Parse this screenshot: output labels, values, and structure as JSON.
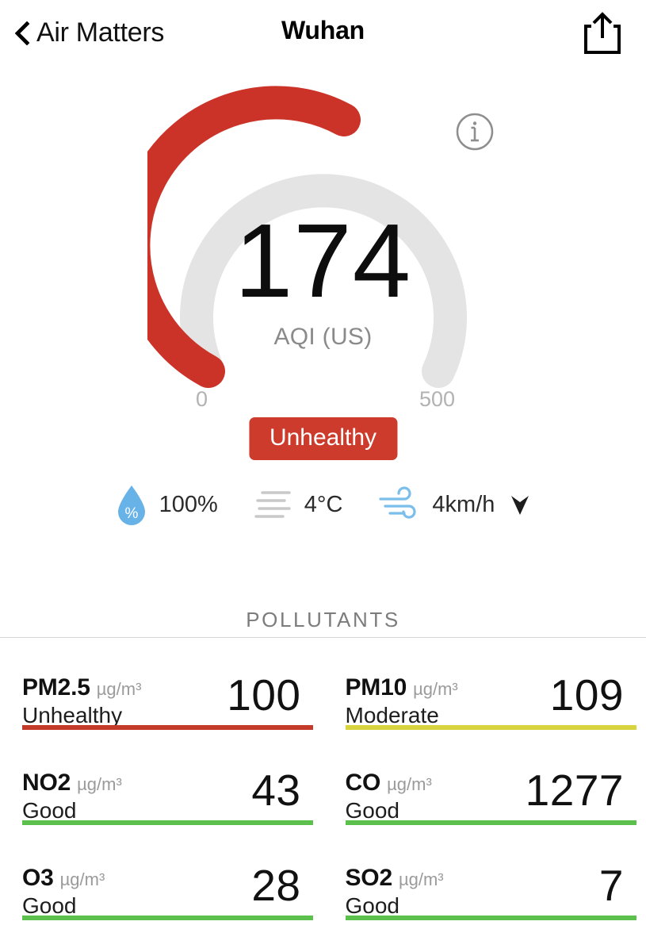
{
  "header": {
    "back_label": "Air Matters",
    "title": "Wuhan",
    "back_icon": "chevron-left-icon",
    "share_icon": "share-icon"
  },
  "gauge": {
    "value": "174",
    "unit_label": "AQI (US)",
    "scale_min": "0",
    "scale_max": "500",
    "info_icon": "info-circle-icon",
    "status_label": "Unhealthy"
  },
  "weather": {
    "humidity": {
      "icon": "humidity-droplet-icon",
      "value": "100%"
    },
    "temperature": {
      "icon": "temperature-lines-icon",
      "value": "4°C"
    },
    "wind": {
      "icon": "wind-icon",
      "value": "4km/h",
      "direction_icon": "wind-direction-arrow-icon"
    }
  },
  "pollutants": {
    "section_title": "POLLUTANTS",
    "items": [
      {
        "name": "PM2.5",
        "unit": "µg/m³",
        "status": "Unhealthy",
        "value": "100",
        "color": "#C33A28"
      },
      {
        "name": "PM10",
        "unit": "µg/m³",
        "status": "Moderate",
        "value": "109",
        "color": "#D8D43F"
      },
      {
        "name": "NO2",
        "unit": "µg/m³",
        "status": "Good",
        "value": "43",
        "color": "#5CC14C"
      },
      {
        "name": "CO",
        "unit": "µg/m³",
        "status": "Good",
        "value": "1277",
        "color": "#5CC14C"
      },
      {
        "name": "O3",
        "unit": "µg/m³",
        "status": "Good",
        "value": "28",
        "color": "#5CC14C"
      },
      {
        "name": "SO2",
        "unit": "µg/m³",
        "status": "Good",
        "value": "7",
        "color": "#5CC14C"
      }
    ]
  },
  "chart_data": {
    "type": "gauge",
    "title": "AQI (US)",
    "value": 174,
    "range": [
      0,
      500
    ],
    "fill_color": "#CC3328",
    "track_color": "#E4E4E4",
    "category": "Unhealthy",
    "tick_labels": [
      "0",
      "500"
    ],
    "series": [
      {
        "name": "PM2.5",
        "value": 100,
        "unit": "µg/m³",
        "category": "Unhealthy",
        "color": "#C33A28"
      },
      {
        "name": "PM10",
        "value": 109,
        "unit": "µg/m³",
        "category": "Moderate",
        "color": "#D8D43F"
      },
      {
        "name": "NO2",
        "value": 43,
        "unit": "µg/m³",
        "category": "Good",
        "color": "#5CC14C"
      },
      {
        "name": "CO",
        "value": 1277,
        "unit": "µg/m³",
        "category": "Good",
        "color": "#5CC14C"
      },
      {
        "name": "O3",
        "value": 28,
        "unit": "µg/m³",
        "category": "Good",
        "color": "#5CC14C"
      },
      {
        "name": "SO2",
        "value": 7,
        "unit": "µg/m³",
        "category": "Good",
        "color": "#5CC14C"
      }
    ]
  },
  "colors": {
    "aqi_red": "#CC3328",
    "badge_red": "#CC3B2B",
    "track_gray": "#E4E4E4",
    "weather_blue": "#67B3E8"
  }
}
